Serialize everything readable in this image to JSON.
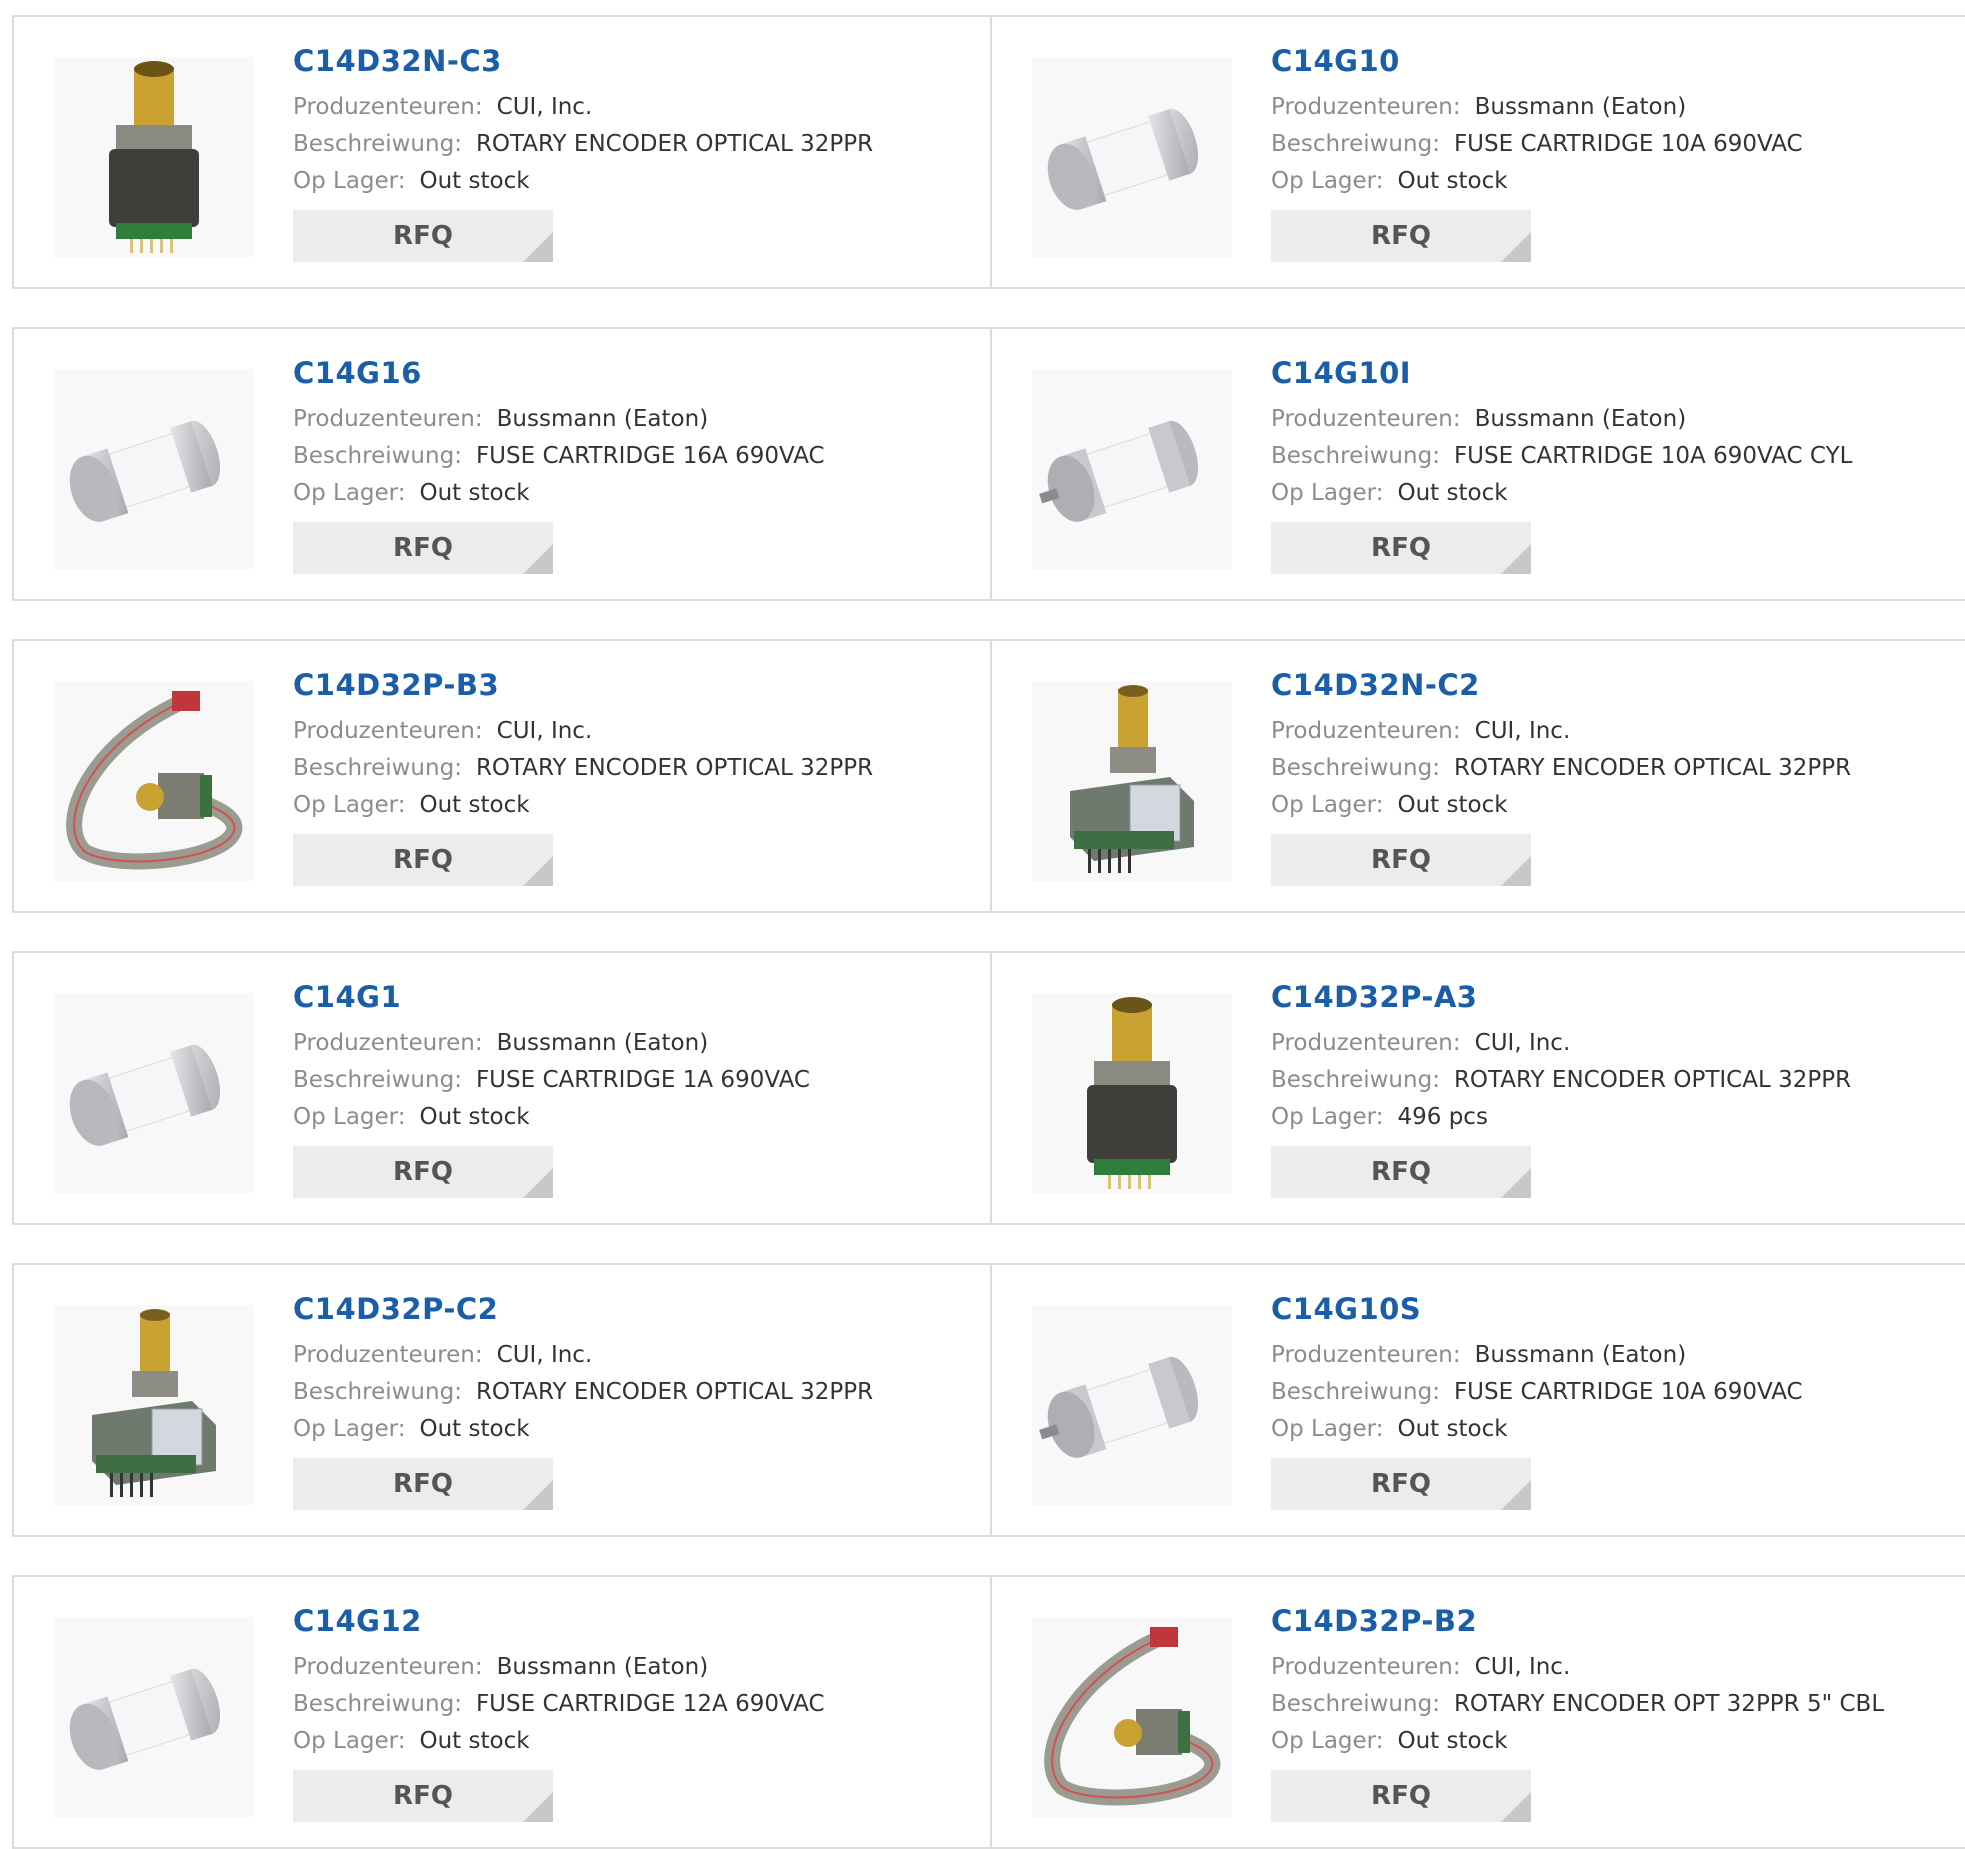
{
  "labels": {
    "manufacturer": "Produzenteuren:",
    "description": "Beschreiwung:",
    "stock": "Op Lager:",
    "rfq": "RFQ"
  },
  "products": [
    {
      "part": "C14D32N-C3",
      "manufacturer": "CUI, Inc.",
      "description": "ROTARY ENCODER OPTICAL 32PPR",
      "stock": "Out stock",
      "image": "rotary-encoder-upright-icon"
    },
    {
      "part": "C14G10",
      "manufacturer": "Bussmann (Eaton)",
      "description": "FUSE CARTRIDGE 10A 690VAC",
      "stock": "Out stock",
      "image": "fuse-cartridge-icon"
    },
    {
      "part": "C14G16",
      "manufacturer": "Bussmann (Eaton)",
      "description": "FUSE CARTRIDGE 16A 690VAC",
      "stock": "Out stock",
      "image": "fuse-cartridge-icon"
    },
    {
      "part": "C14G10I",
      "manufacturer": "Bussmann (Eaton)",
      "description": "FUSE CARTRIDGE 10A 690VAC CYL",
      "stock": "Out stock",
      "image": "fuse-cartridge-pin-icon"
    },
    {
      "part": "C14D32P-B3",
      "manufacturer": "CUI, Inc.",
      "description": "ROTARY ENCODER OPTICAL 32PPR",
      "stock": "Out stock",
      "image": "rotary-encoder-cable-icon"
    },
    {
      "part": "C14D32N-C2",
      "manufacturer": "CUI, Inc.",
      "description": "ROTARY ENCODER OPTICAL 32PPR",
      "stock": "Out stock",
      "image": "rotary-encoder-pcb-icon"
    },
    {
      "part": "C14G1",
      "manufacturer": "Bussmann (Eaton)",
      "description": "FUSE CARTRIDGE 1A 690VAC",
      "stock": "Out stock",
      "image": "fuse-cartridge-icon"
    },
    {
      "part": "C14D32P-A3",
      "manufacturer": "CUI, Inc.",
      "description": "ROTARY ENCODER OPTICAL 32PPR",
      "stock": "496 pcs",
      "image": "rotary-encoder-upright-icon"
    },
    {
      "part": "C14D32P-C2",
      "manufacturer": "CUI, Inc.",
      "description": "ROTARY ENCODER OPTICAL 32PPR",
      "stock": "Out stock",
      "image": "rotary-encoder-pcb-icon"
    },
    {
      "part": "C14G10S",
      "manufacturer": "Bussmann (Eaton)",
      "description": "FUSE CARTRIDGE 10A 690VAC",
      "stock": "Out stock",
      "image": "fuse-cartridge-pin-icon"
    },
    {
      "part": "C14G12",
      "manufacturer": "Bussmann (Eaton)",
      "description": "FUSE CARTRIDGE 12A 690VAC",
      "stock": "Out stock",
      "image": "fuse-cartridge-icon"
    },
    {
      "part": "C14D32P-B2",
      "manufacturer": "CUI, Inc.",
      "description": "ROTARY ENCODER OPT 32PPR 5\" CBL",
      "stock": "Out stock",
      "image": "rotary-encoder-cable-icon"
    }
  ]
}
